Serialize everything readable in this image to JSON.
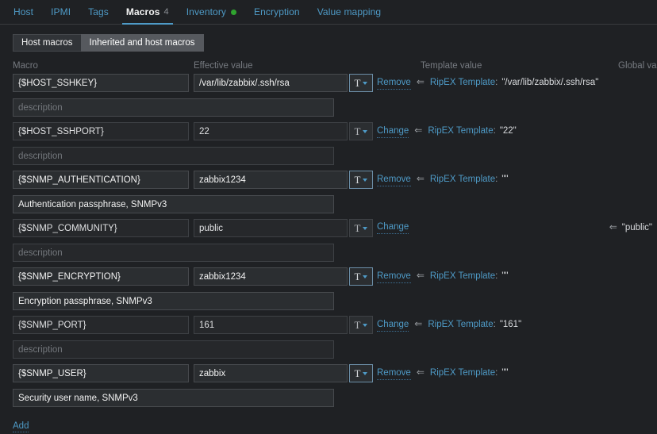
{
  "tabs": [
    {
      "label": "Host",
      "active": false,
      "count": "",
      "dot": false
    },
    {
      "label": "IPMI",
      "active": false,
      "count": "",
      "dot": false
    },
    {
      "label": "Tags",
      "active": false,
      "count": "",
      "dot": false
    },
    {
      "label": "Macros",
      "active": true,
      "count": "4",
      "dot": false
    },
    {
      "label": "Inventory",
      "active": false,
      "count": "",
      "dot": true
    },
    {
      "label": "Encryption",
      "active": false,
      "count": "",
      "dot": false
    },
    {
      "label": "Value mapping",
      "active": false,
      "count": "",
      "dot": false
    }
  ],
  "toggle": {
    "host_macros_label": "Host macros",
    "inherited_label": "Inherited and host macros",
    "selected": "Inherited and host macros"
  },
  "headers": {
    "macro": "Macro",
    "effective_value": "Effective value",
    "template_value": "Template value",
    "global_value": "Global va"
  },
  "value_type_button": {
    "glyph": "T",
    "chevron": "chevron-down-icon"
  },
  "inherit_arrow": "⇐",
  "add_label": "Add",
  "rows": [
    {
      "macro": "{$HOST_SSHKEY}",
      "value": "/var/lib/zabbix/.ssh/rsa",
      "description": "",
      "description_placeholder": "description",
      "readonly": false,
      "highlighted": true,
      "action": "Remove",
      "template_name": "RipEX Template",
      "template_value": "\"/var/lib/zabbix/.ssh/rsa\"",
      "global_value": ""
    },
    {
      "macro": "{$HOST_SSHPORT}",
      "value": "22",
      "description": "",
      "description_placeholder": "description",
      "readonly": true,
      "highlighted": false,
      "action": "Change",
      "template_name": "RipEX Template",
      "template_value": "\"22\"",
      "global_value": ""
    },
    {
      "macro": "{$SNMP_AUTHENTICATION}",
      "value": "zabbix1234",
      "description": "Authentication passphrase, SNMPv3",
      "description_placeholder": "description",
      "readonly": false,
      "highlighted": true,
      "action": "Remove",
      "template_name": "RipEX Template",
      "template_value": "\"\"",
      "global_value": ""
    },
    {
      "macro": "{$SNMP_COMMUNITY}",
      "value": "public",
      "description": "",
      "description_placeholder": "description",
      "readonly": true,
      "highlighted": false,
      "action": "Change",
      "template_name": "",
      "template_value": "",
      "global_value": "\"public\""
    },
    {
      "macro": "{$SNMP_ENCRYPTION}",
      "value": "zabbix1234",
      "description": "Encryption passphrase, SNMPv3",
      "description_placeholder": "description",
      "readonly": false,
      "highlighted": true,
      "action": "Remove",
      "template_name": "RipEX Template",
      "template_value": "\"\"",
      "global_value": ""
    },
    {
      "macro": "{$SNMP_PORT}",
      "value": "161",
      "description": "",
      "description_placeholder": "description",
      "readonly": true,
      "highlighted": false,
      "action": "Change",
      "template_name": "RipEX Template",
      "template_value": "\"161\"",
      "global_value": ""
    },
    {
      "macro": "{$SNMP_USER}",
      "value": "zabbix",
      "description": "Security user name, SNMPv3",
      "description_placeholder": "description",
      "readonly": false,
      "highlighted": true,
      "action": "Remove",
      "template_name": "RipEX Template",
      "template_value": "\"\"",
      "global_value": ""
    }
  ]
}
